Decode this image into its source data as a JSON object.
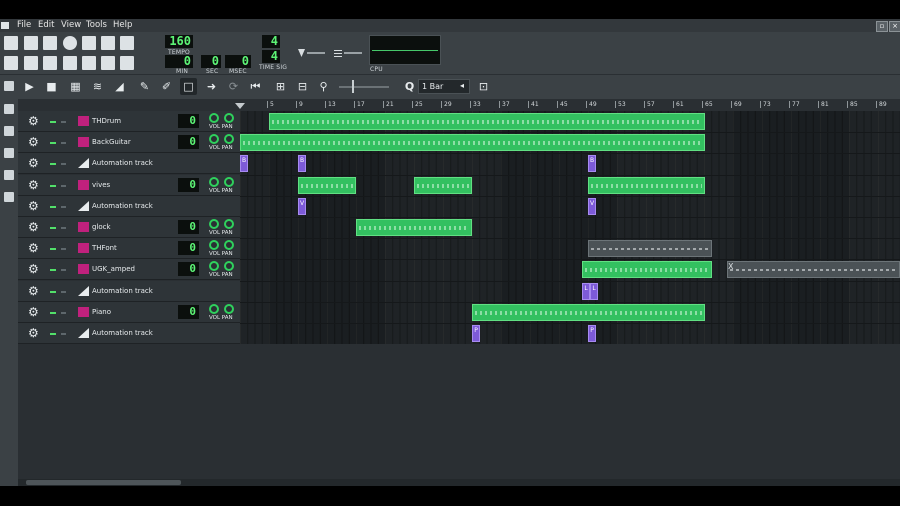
{
  "menu": [
    "File",
    "Edit",
    "View",
    "Tools",
    "Help"
  ],
  "lcd": {
    "tempo": "160",
    "tempo_label": "TEMPO",
    "min": "0",
    "sec": "0",
    "msec": "0",
    "min_label": "MIN",
    "sec_label": "SEC",
    "msec_label": "MSEC",
    "timesig_top": "4",
    "timesig_bottom": "4",
    "timesig_label": "TIME SIG",
    "cpu_label": "CPU"
  },
  "song_toolbar": {
    "zoom_value": "1 Bar"
  },
  "ruler": [
    "5",
    "9",
    "13",
    "17",
    "21",
    "25",
    "29",
    "33",
    "37",
    "41",
    "45",
    "49",
    "53",
    "57",
    "61",
    "65",
    "69",
    "73",
    "77",
    "81",
    "85",
    "89"
  ],
  "tracks": [
    {
      "name": "THDrum",
      "type": "instrument",
      "volume": "0",
      "knob_label": "VOL PAN"
    },
    {
      "name": "BackGuitar",
      "type": "instrument",
      "volume": "0",
      "knob_label": "VOL PAN"
    },
    {
      "name": "Automation track",
      "type": "automation"
    },
    {
      "name": "vives",
      "type": "instrument",
      "volume": "0",
      "knob_label": "VOL PAN"
    },
    {
      "name": "Automation track",
      "type": "automation"
    },
    {
      "name": "glock",
      "type": "instrument",
      "volume": "0",
      "knob_label": "VOL PAN"
    },
    {
      "name": "THFont",
      "type": "instrument",
      "volume": "0",
      "knob_label": "VOL PAN"
    },
    {
      "name": "UGK_amped",
      "type": "instrument",
      "volume": "0",
      "knob_label": "VOL PAN"
    },
    {
      "name": "Automation track",
      "type": "automation"
    },
    {
      "name": "Piano",
      "type": "instrument",
      "volume": "0",
      "knob_label": "VOL PAN"
    },
    {
      "name": "Automation track",
      "type": "automation"
    }
  ],
  "automation_labels": {
    "b": "B",
    "v": "V",
    "l": "L",
    "p": "P",
    "x": "X"
  },
  "colors": {
    "pattern": "#33c060",
    "automation": "#7d5ad8",
    "lcd_text": "#5df576",
    "muted_pattern": "#4b5256"
  }
}
